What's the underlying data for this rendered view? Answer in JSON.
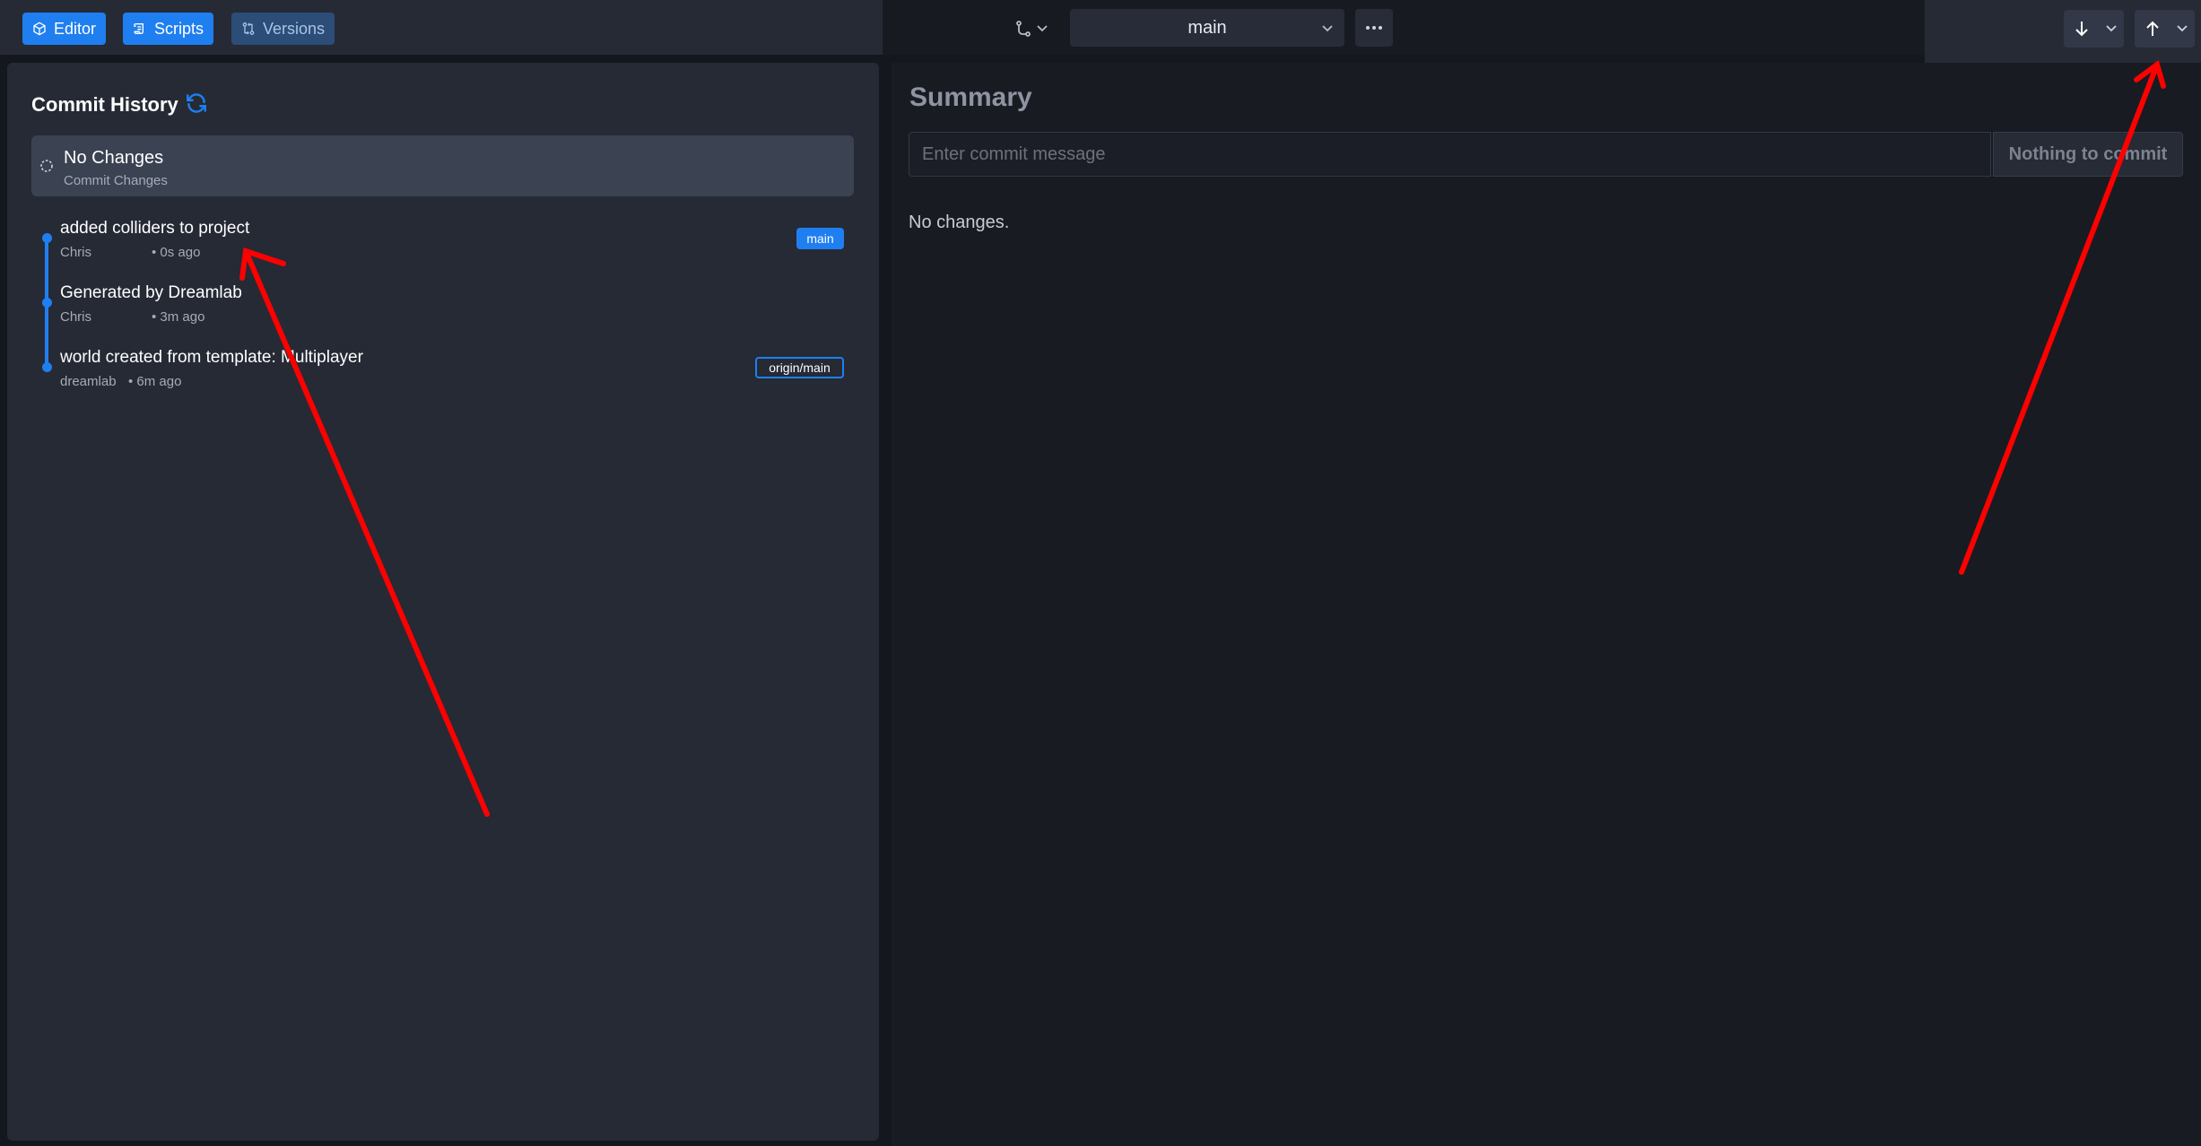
{
  "toolbar": {
    "tabs": [
      {
        "label": "Editor",
        "icon": "cube-icon"
      },
      {
        "label": "Scripts",
        "icon": "scroll-icon"
      },
      {
        "label": "Versions",
        "icon": "git-compare-icon"
      }
    ],
    "branch_select": {
      "value": "main"
    },
    "more_icon": "ellipsis-icon",
    "pull_icon": "arrow-down-icon",
    "push_icon": "arrow-up-icon"
  },
  "commit_history": {
    "title": "Commit History",
    "pending": {
      "title": "No Changes",
      "subtitle": "Commit Changes"
    },
    "commits": [
      {
        "message": "added colliders to project",
        "author": "Chris",
        "time": "• 0s ago",
        "badge": "main"
      },
      {
        "message": "Generated by Dreamlab",
        "author": "Chris",
        "time": "• 3m ago",
        "badge": ""
      },
      {
        "message": "world created from template: Multiplayer",
        "author": "dreamlab",
        "time": "• 6m ago",
        "badge": "origin/main"
      }
    ]
  },
  "summary": {
    "title": "Summary",
    "commit_placeholder": "Enter commit message",
    "commit_button": "Nothing to commit",
    "status": "No changes."
  },
  "colors": {
    "accent": "#1f7ff0",
    "annotation_arrow": "#ff0000"
  }
}
